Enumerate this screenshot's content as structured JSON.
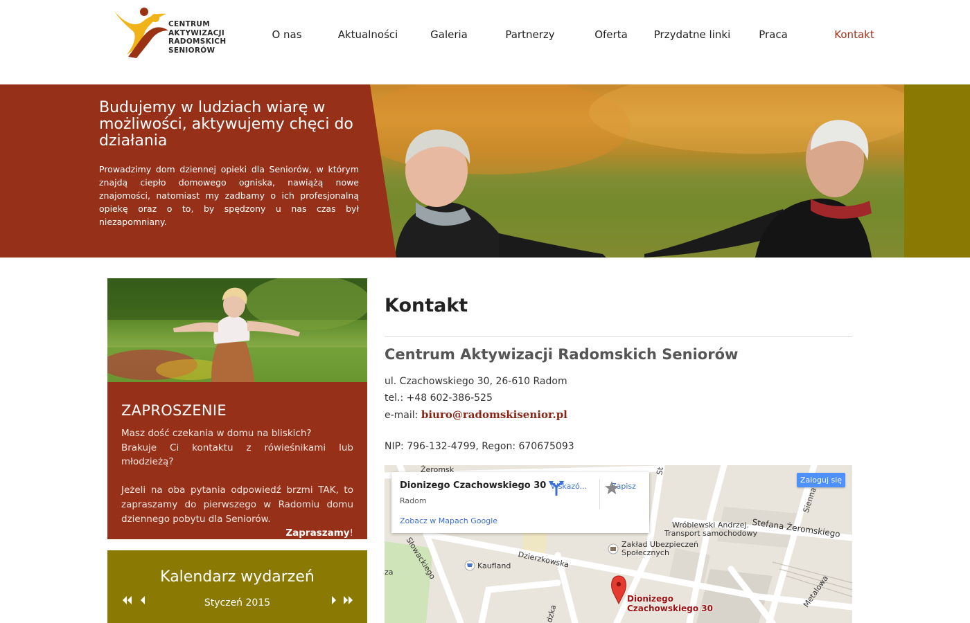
{
  "logo": {
    "line1": "CENTRUM",
    "line2": "AKTYWIZACJI",
    "line3": "RADOMSKICH",
    "line4": "SENIORÓW"
  },
  "nav": {
    "items": [
      {
        "label": "O nas"
      },
      {
        "label": "Aktualności"
      },
      {
        "label": "Galeria"
      },
      {
        "label": "Partnerzy"
      },
      {
        "label": "Oferta"
      },
      {
        "label": "Przydatne linki"
      },
      {
        "label": "Praca"
      },
      {
        "label": "Kontakt"
      }
    ]
  },
  "hero": {
    "title": "Budujemy w ludziach wiarę w możliwości, aktywujemy chęci do działania",
    "text": "Prowadzimy dom dziennej opieki dla Seniorów, w którym znajdą ciepło domowego ogniska, nawiążą nowe znajomości, natomiast my zadbamy o ich profesjonalną opiekę oraz o to, by spędzony u nas czas był niezapomniany."
  },
  "invite": {
    "title": "ZAPROSZENIE",
    "q1": "Masz dość czekania w domu na bliskich?",
    "q2": "Brakuje Ci kontaktu z rówieśnikami lub młodzieżą?",
    "body": "Jeżeli na oba pytania odpowiedź brzmi TAK, to zapraszamy do pierwszego w Radomiu domu dziennego pobytu dla Seniorów.",
    "cta": "Zapraszamy",
    "cta_suffix": "!"
  },
  "calendar": {
    "title": "Kalendarz wydarzeń",
    "month": "Styczeń 2015"
  },
  "contact": {
    "title": "Kontakt",
    "org": "Centrum Aktywizacji Radomskich Seniorów",
    "address": "ul. Czachowskiego 30, 26-610 Radom",
    "phone": "tel.: +48 602-386-525",
    "email_label": "e-mail: ",
    "email": "biuro@radomskisenior.pl",
    "ids": "NIP: 796-132-4799, Regon: 670675093"
  },
  "map": {
    "card_title": "Dionizego Czachowskiego 30",
    "card_sub": "Radom",
    "card_link": "Zobacz w Mapach Google",
    "directions": "Wskazó...",
    "save": "Zapisz",
    "login": "Zaloguj się",
    "labels": {
      "zeromsk_top": "Żeromsk",
      "st": "St",
      "wroblewski1": "Wróblewski Andrzej.",
      "wroblewski2": "Transport samochodowy",
      "zeromskiego": "Stefana Żeromskiego",
      "sienna": "Sienna",
      "zaklad1": "Zakład Ubezpieczeń",
      "zaklad2": "Społecznych",
      "dzierzkowska": "Dzierzkowska",
      "kaufland": "Kaufland",
      "slowackiego": "Słowackiego",
      "za": "za",
      "metalowa": "Metalowa",
      "dzka": "dzka",
      "pin1": "Dionizego",
      "pin2": "Czachowskiego 30"
    }
  }
}
